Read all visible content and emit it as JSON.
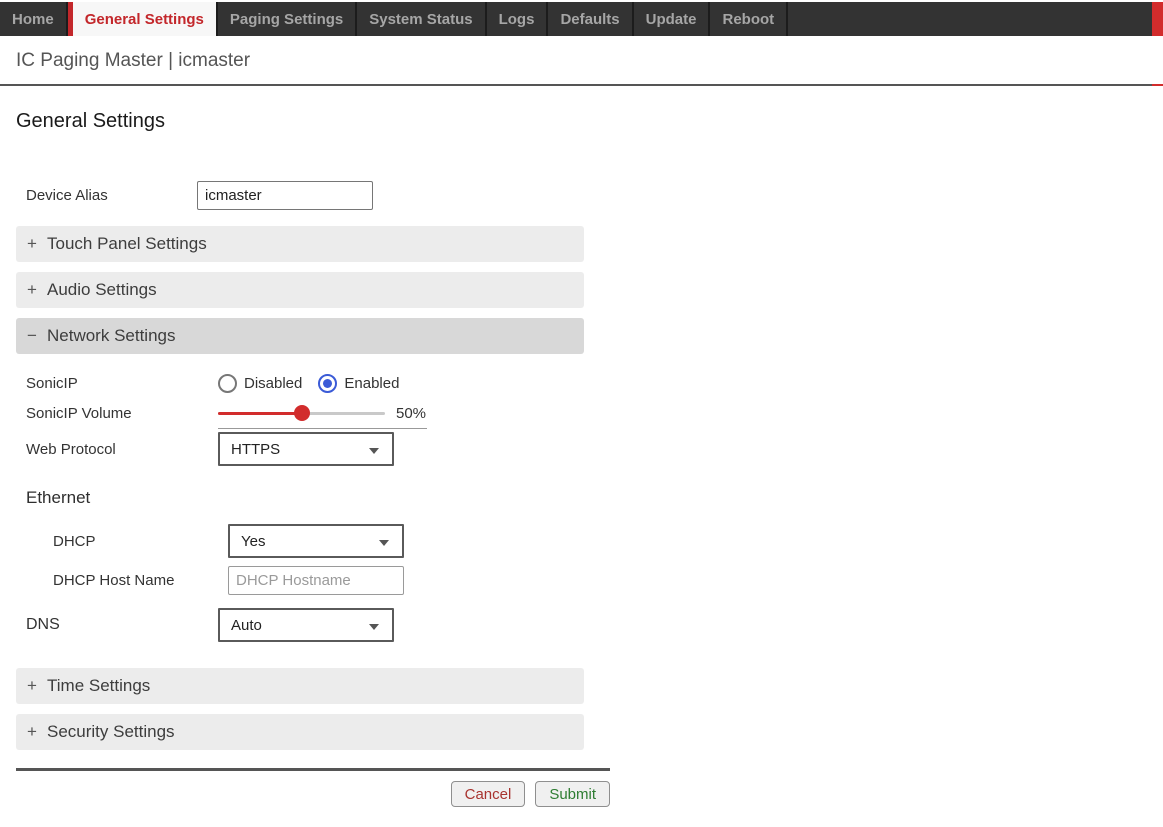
{
  "nav": {
    "tabs": [
      {
        "label": "Home",
        "active": false
      },
      {
        "label": "General Settings",
        "active": true
      },
      {
        "label": "Paging Settings",
        "active": false
      },
      {
        "label": "System Status",
        "active": false
      },
      {
        "label": "Logs",
        "active": false
      },
      {
        "label": "Defaults",
        "active": false
      },
      {
        "label": "Update",
        "active": false
      },
      {
        "label": "Reboot",
        "active": false
      }
    ]
  },
  "header": {
    "title": "IC Paging Master | icmaster"
  },
  "page": {
    "heading": "General Settings"
  },
  "form": {
    "device_alias": {
      "label": "Device Alias",
      "value": "icmaster"
    },
    "sections": [
      {
        "label": "Touch Panel Settings",
        "state_icon": "+",
        "expanded": false
      },
      {
        "label": "Audio Settings",
        "state_icon": "+",
        "expanded": false
      },
      {
        "label": "Network Settings",
        "state_icon": "−",
        "expanded": true
      },
      {
        "label": "Time Settings",
        "state_icon": "+",
        "expanded": false
      },
      {
        "label": "Security Settings",
        "state_icon": "+",
        "expanded": false
      }
    ],
    "network": {
      "sonicip": {
        "label": "SonicIP",
        "options": [
          {
            "label": "Disabled",
            "selected": false
          },
          {
            "label": "Enabled",
            "selected": true
          }
        ]
      },
      "sonicip_volume": {
        "label": "SonicIP Volume",
        "percent": 50,
        "value_text": "50%"
      },
      "web_protocol": {
        "label": "Web Protocol",
        "value": "HTTPS"
      },
      "ethernet_heading": "Ethernet",
      "dhcp": {
        "label": "DHCP",
        "value": "Yes"
      },
      "dhcp_hostname": {
        "label": "DHCP Host Name",
        "value": "",
        "placeholder": "DHCP Hostname"
      },
      "dns": {
        "label": "DNS",
        "value": "Auto"
      }
    },
    "buttons": {
      "cancel": "Cancel",
      "submit": "Submit"
    }
  },
  "colors": {
    "accent_red": "#c3272b",
    "slider_red": "#d22c2c",
    "radio_blue": "#3b5bd7",
    "cancel_text": "#a8332f",
    "submit_text": "#2e7d32",
    "navbar_bg": "#333333",
    "accordion_collapsed_bg": "#ececec",
    "accordion_expanded_bg": "#d8d8d8"
  }
}
